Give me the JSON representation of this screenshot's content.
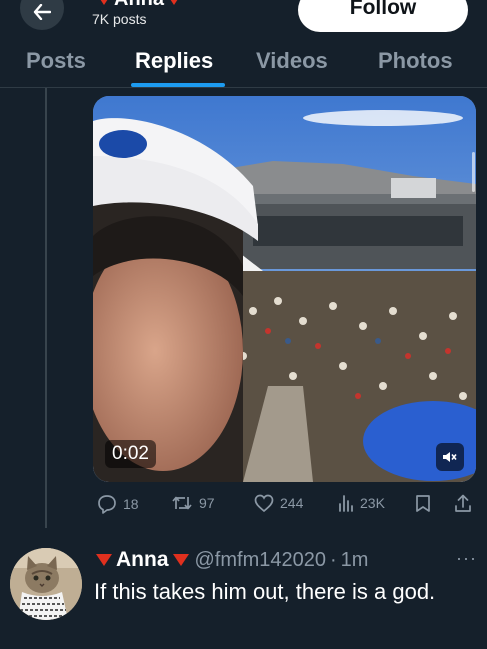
{
  "header": {
    "name": "Anna",
    "posts_count": "7K posts",
    "follow_label": "Follow"
  },
  "tabs": [
    {
      "label": "Posts",
      "active": false
    },
    {
      "label": "Replies",
      "active": true
    },
    {
      "label": "Videos",
      "active": false
    },
    {
      "label": "Photos",
      "active": false
    }
  ],
  "video": {
    "timestamp": "0:02",
    "muted": true
  },
  "actions": {
    "replies": "18",
    "reposts": "97",
    "likes": "244",
    "views": "23K"
  },
  "reply": {
    "name": "Anna",
    "handle": "@fmfm142020",
    "separator": "·",
    "time": "1m",
    "text": "If this takes him out, there is a god."
  },
  "colors": {
    "background": "#15202b",
    "accent": "#1d9bf0",
    "flag_red": "#e0301e",
    "muted_text": "#8b98a5"
  },
  "icons": [
    "back-arrow-icon",
    "reply-icon",
    "repost-icon",
    "like-icon",
    "views-icon",
    "bookmark-icon",
    "share-icon",
    "mute-icon",
    "more-icon"
  ]
}
